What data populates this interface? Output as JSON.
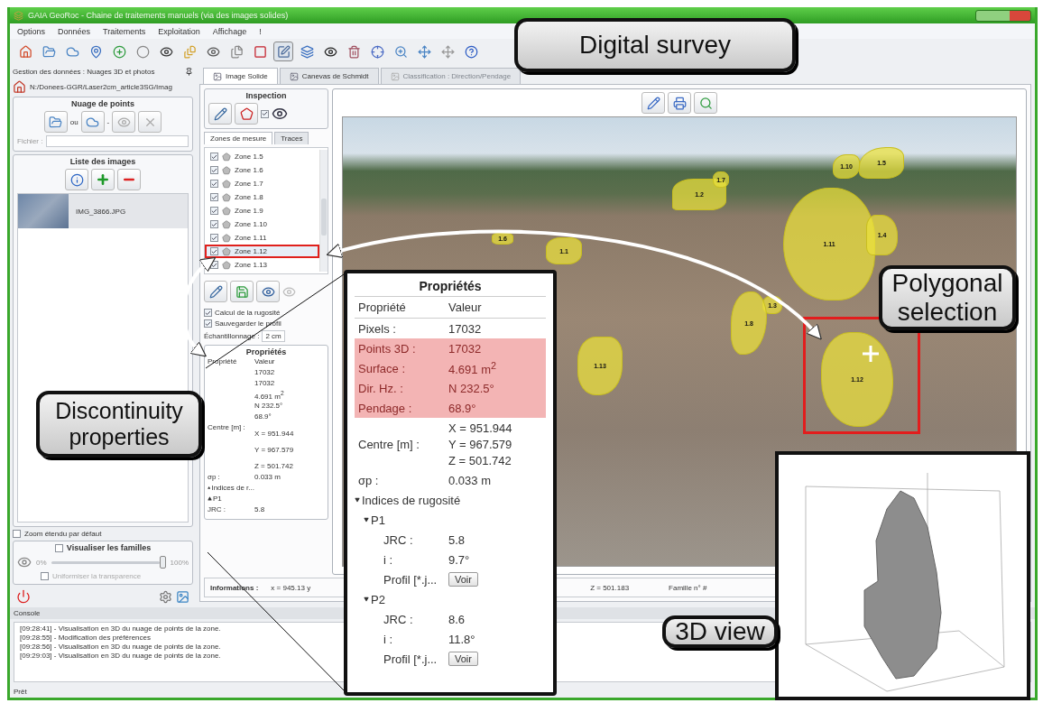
{
  "window": {
    "title": "GAIA GeoRoc - Chaine de traitements manuels (via des images solides)"
  },
  "menu": [
    "Options",
    "Données",
    "Traitements",
    "Exploitation",
    "Affichage",
    "!"
  ],
  "toolbar": [
    {
      "selected": false
    },
    {
      "selected": false
    },
    {
      "selected": false
    },
    {
      "selected": false
    },
    {
      "selected": false
    },
    {
      "selected": false
    },
    {
      "selected": false
    },
    {
      "selected": false
    },
    {
      "selected": false
    },
    {
      "selected": false
    },
    {
      "selected": false
    },
    {
      "selected": true
    },
    {
      "selected": false
    },
    {
      "selected": false
    },
    {
      "selected": false
    },
    {
      "selected": false
    },
    {
      "selected": false
    },
    {
      "selected": false
    },
    {
      "selected": false
    },
    {
      "selected": false
    }
  ],
  "left_dock": {
    "title": "Gestion des données : Nuages 3D et photos",
    "path": "N:/Donees-GGR/Laser2cm_article3SG/Imag",
    "point_cloud": {
      "title": "Nuage de points",
      "or_label": "ou",
      "dash": "-",
      "file_label": "Fichier :"
    },
    "images": {
      "title": "Liste des images",
      "items": [
        {
          "name": "IMG_3866.JPG",
          "selected": true
        }
      ]
    },
    "zoom_default": {
      "label": "Zoom étendu par défaut",
      "checked": false
    },
    "families": {
      "title": "Visualiser les familles",
      "checked": false,
      "min": "0%",
      "max": "100%",
      "level": 1,
      "uniform": {
        "label": "Uniformiser la transparence",
        "checked": false
      }
    }
  },
  "tabs": [
    {
      "label": "Image Solide",
      "selected": true,
      "disabled": false
    },
    {
      "label": "Canevas de Schmidt",
      "selected": false,
      "disabled": false
    },
    {
      "label": "Classification : Direction/Pendage",
      "selected": false,
      "disabled": true
    }
  ],
  "inspection": {
    "title": "Inspection",
    "show_checked": true,
    "tabs": [
      {
        "label": "Zones de mesure",
        "selected": true
      },
      {
        "label": "Traces",
        "selected": false
      }
    ],
    "zones": [
      {
        "label": "Zone 1.5",
        "checked": true,
        "selected": false
      },
      {
        "label": "Zone 1.6",
        "checked": true,
        "selected": false
      },
      {
        "label": "Zone 1.7",
        "checked": true,
        "selected": false
      },
      {
        "label": "Zone 1.8",
        "checked": true,
        "selected": false
      },
      {
        "label": "Zone 1.9",
        "checked": true,
        "selected": false
      },
      {
        "label": "Zone 1.10",
        "checked": true,
        "selected": false
      },
      {
        "label": "Zone 1.11",
        "checked": true,
        "selected": false
      },
      {
        "label": "Zone 1.12",
        "checked": true,
        "selected": true
      },
      {
        "label": "Zone 1.13",
        "checked": true,
        "selected": false
      }
    ],
    "options": [
      {
        "label": "Calcul de la rugosité",
        "checked": true
      },
      {
        "label": "Sauvegarder le profil",
        "checked": true
      }
    ],
    "sampling": {
      "label": "Échantillonnage :",
      "value": "2 cm"
    }
  },
  "small_properties": {
    "title": "Propriétés",
    "columns": [
      "Propriété",
      "Valeur"
    ],
    "rows": [
      {
        "value": "17032"
      },
      {
        "value": "17032"
      },
      {
        "value": "4.691 m$^{2}$"
      },
      {
        "value": "N 232.5°"
      },
      {
        "value": "68.9°"
      },
      {
        "label": "Centre [m] :",
        "value_lines": [
          "X = 951.944",
          "Y = 967.579",
          "Z = 501.742"
        ]
      },
      {
        "label": "σp :",
        "value": "0.033 m"
      },
      {
        "label": "Indices de r...",
        "kind": "group"
      },
      {
        "label": "P1",
        "kind": "group"
      },
      {
        "label": "JRC :",
        "value": "5.8"
      }
    ]
  },
  "viewer": {
    "zones": [
      {
        "label": "1.2"
      },
      {
        "label": "1.7"
      },
      {
        "label": "1.10"
      },
      {
        "label": "1.5"
      },
      {
        "label": "1.11"
      },
      {
        "label": "1.4"
      },
      {
        "label": "1.6"
      },
      {
        "label": "1.1"
      },
      {
        "label": "1.3"
      },
      {
        "label": "1.8"
      },
      {
        "label": "1.12"
      },
      {
        "label": "1.13"
      }
    ]
  },
  "info": {
    "label": "Informations :",
    "fields": [
      "x = 945.13 y",
      "Z = 501.183",
      "Famille n° #"
    ]
  },
  "console": {
    "title": "Console",
    "lines": [
      "[09:28:41] - Visualisation en 3D du nuage de points de la zone.",
      "[09:28:55] - Modification des préférences",
      "[09:28:56] - Visualisation en 3D du nuage de points de la zone.",
      "[09:29:03] - Visualisation en 3D du nuage de points de la zone."
    ]
  },
  "status": "Prêt",
  "callouts": [
    {
      "text": "Digital survey"
    },
    {
      "text": "Discontinuity properties"
    },
    {
      "text": "Polygonal selection"
    },
    {
      "text": "3D view"
    }
  ],
  "properties_zoom": {
    "title": "Propriétés",
    "columns": [
      "Propriété",
      "Valeur"
    ],
    "rows": [
      {
        "label": "Pixels :",
        "value": "17032",
        "highlighted": false
      },
      {
        "label": "Points 3D :",
        "value": "17032",
        "highlighted": true
      },
      {
        "label": "Surface :",
        "value": "4.691 m$^{2}$",
        "highlighted": true
      },
      {
        "label": "Dir. Hz. :",
        "value": "N 232.5°",
        "highlighted": true
      },
      {
        "label": "Pendage :",
        "value": "68.9°",
        "highlighted": true
      },
      {
        "label": "Centre [m] :",
        "value_lines": [
          "X = 951.944",
          "Y = 967.579",
          "Z = 501.742"
        ],
        "highlighted": false
      },
      {
        "label": "σp :",
        "value": "0.033 m",
        "highlighted": false
      },
      {
        "label": "Indices de rugosité",
        "expanded": true,
        "children": [
          {
            "label": "P1",
            "expanded": true,
            "children": [
              {
                "label": "JRC :",
                "value": "5.8"
              },
              {
                "label": "i :",
                "value": "9.7°"
              },
              {
                "label": "Profil [*.j...",
                "button": "Voir"
              }
            ]
          },
          {
            "label": "P2",
            "expanded": true,
            "children": [
              {
                "label": "JRC :",
                "value": "8.6"
              },
              {
                "label": "i :",
                "value": "11.8°"
              },
              {
                "label": "Profil [*.j...",
                "button": "Voir"
              }
            ]
          }
        ]
      }
    ]
  }
}
